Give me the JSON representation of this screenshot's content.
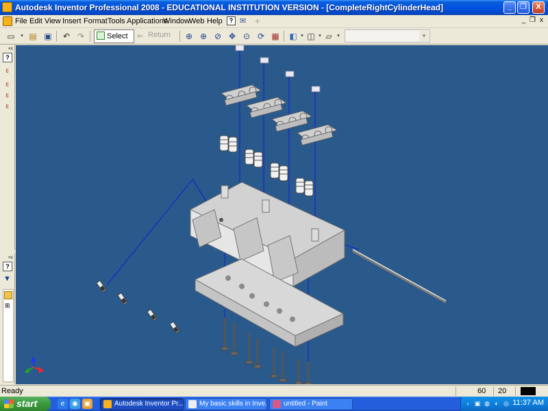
{
  "window": {
    "title": "Autodesk Inventor Professional 2008 - EDUCATIONAL INSTITUTION VERSION - [CompleteRightCylinderHead]",
    "minimize_label": "_",
    "restore_label": "❐",
    "close_label": "X"
  },
  "menubar": {
    "items": [
      "File",
      "Edit",
      "View",
      "Insert",
      "Format",
      "Tools",
      "Applications",
      "Window",
      "Web",
      "Help"
    ],
    "mdi_min": "_",
    "mdi_restore": "❐",
    "mdi_close": "x"
  },
  "toolbar": {
    "select_label": "Select",
    "return_label": "Return",
    "combo_value": ""
  },
  "viewport": {
    "background": "#2a5a8b",
    "line_color": "#1428c8",
    "part_color": "#d9d9d9"
  },
  "statusbar": {
    "status": "Ready",
    "count1": "60",
    "count2": "20"
  },
  "taskbar": {
    "start_label": "start",
    "tasks": [
      {
        "label": "Autodesk Inventor Pr..."
      },
      {
        "label": "My basic skills in Inve..."
      },
      {
        "label": "untitled - Paint"
      }
    ],
    "clock": "11:37 AM"
  }
}
